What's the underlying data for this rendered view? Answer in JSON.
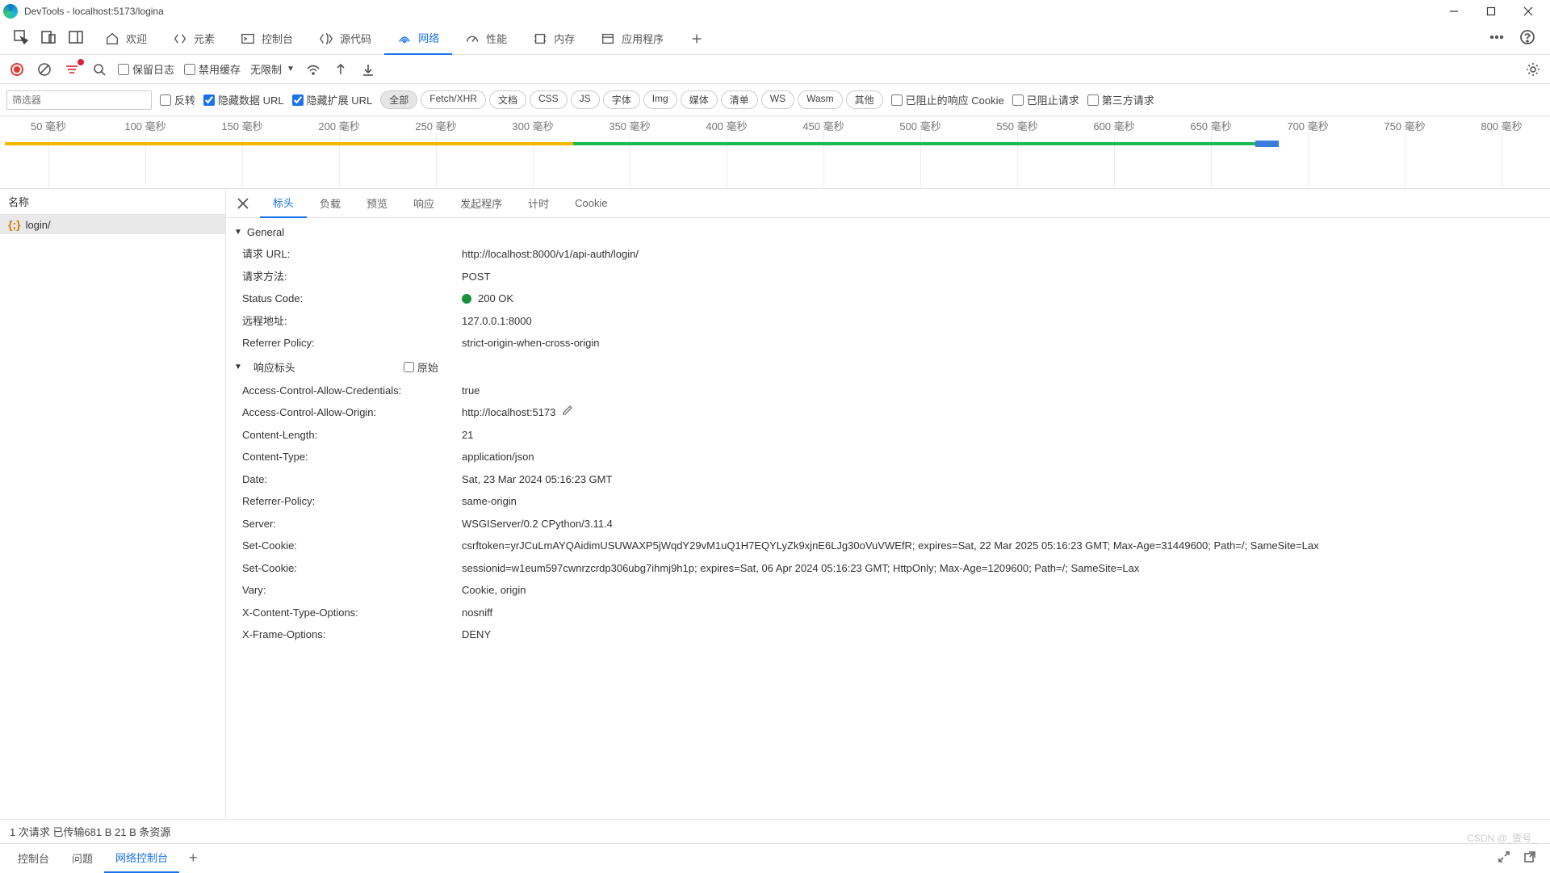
{
  "window": {
    "title": "DevTools - localhost:5173/logina"
  },
  "tabs": {
    "welcome": "欢迎",
    "elements": "元素",
    "console": "控制台",
    "sources": "源代码",
    "network": "网络",
    "performance": "性能",
    "memory": "内存",
    "application": "应用程序"
  },
  "toolbar": {
    "preserve_log": "保留日志",
    "disable_cache": "禁用缓存",
    "throttle": "无限制"
  },
  "filterbar": {
    "placeholder": "筛选器",
    "invert": "反转",
    "hide_data": "隐藏数据 URL",
    "hide_ext": "隐藏扩展 URL",
    "pills": [
      "全部",
      "Fetch/XHR",
      "文档",
      "CSS",
      "JS",
      "字体",
      "Img",
      "媒体",
      "清单",
      "WS",
      "Wasm",
      "其他"
    ],
    "blocked_cookie": "已阻止的响应 Cookie",
    "blocked_req": "已阻止请求",
    "third_party": "第三方请求"
  },
  "timeline_ticks": [
    "50 毫秒",
    "100 毫秒",
    "150 毫秒",
    "200 毫秒",
    "250 毫秒",
    "300 毫秒",
    "350 毫秒",
    "400 毫秒",
    "450 毫秒",
    "500 毫秒",
    "550 毫秒",
    "600 毫秒",
    "650 毫秒",
    "700 毫秒",
    "750 毫秒",
    "800 毫秒"
  ],
  "reqlist": {
    "header": "名称",
    "item0": "login/"
  },
  "detail_tabs": {
    "headers": "标头",
    "payload": "负载",
    "preview": "预览",
    "response": "响应",
    "initiator": "发起程序",
    "timing": "计时",
    "cookie": "Cookie"
  },
  "sections": {
    "general": "General",
    "response_headers": "响应标头",
    "raw": "原始"
  },
  "general": {
    "url_k": "请求 URL:",
    "url_v": "http://localhost:8000/v1/api-auth/login/",
    "method_k": "请求方法:",
    "method_v": "POST",
    "status_k": "Status Code:",
    "status_v": "200 OK",
    "remote_k": "远程地址:",
    "remote_v": "127.0.0.1:8000",
    "refpol_k": "Referrer Policy:",
    "refpol_v": "strict-origin-when-cross-origin"
  },
  "resp": {
    "acac_k": "Access-Control-Allow-Credentials:",
    "acac_v": "true",
    "acao_k": "Access-Control-Allow-Origin:",
    "acao_v": "http://localhost:5173",
    "clen_k": "Content-Length:",
    "clen_v": "21",
    "ctyp_k": "Content-Type:",
    "ctyp_v": "application/json",
    "date_k": "Date:",
    "date_v": "Sat, 23 Mar 2024 05:16:23 GMT",
    "refp_k": "Referrer-Policy:",
    "refp_v": "same-origin",
    "srv_k": "Server:",
    "srv_v": "WSGIServer/0.2 CPython/3.11.4",
    "sc1_k": "Set-Cookie:",
    "sc1_v": "csrftoken=yrJCuLmAYQAidimUSUWAXP5jWqdY29vM1uQ1H7EQYLyZk9xjnE6LJg30oVuVWEfR; expires=Sat, 22 Mar 2025 05:16:23 GMT; Max-Age=31449600; Path=/; SameSite=Lax",
    "sc2_k": "Set-Cookie:",
    "sc2_v": "sessionid=w1eum597cwnrzcrdp306ubg7ihmj9h1p; expires=Sat, 06 Apr 2024 05:16:23 GMT; HttpOnly; Max-Age=1209600; Path=/; SameSite=Lax",
    "vary_k": "Vary:",
    "vary_v": "Cookie, origin",
    "xcto_k": "X-Content-Type-Options:",
    "xcto_v": "nosniff",
    "xfo_k": "X-Frame-Options:",
    "xfo_v": "DENY"
  },
  "statusbar": "1 次请求   已传输681 B   21 B 条资源",
  "drawer": {
    "console": "控制台",
    "issues": "问题",
    "netconsole": "网络控制台"
  },
  "watermark": "CSDN @_壹号_"
}
